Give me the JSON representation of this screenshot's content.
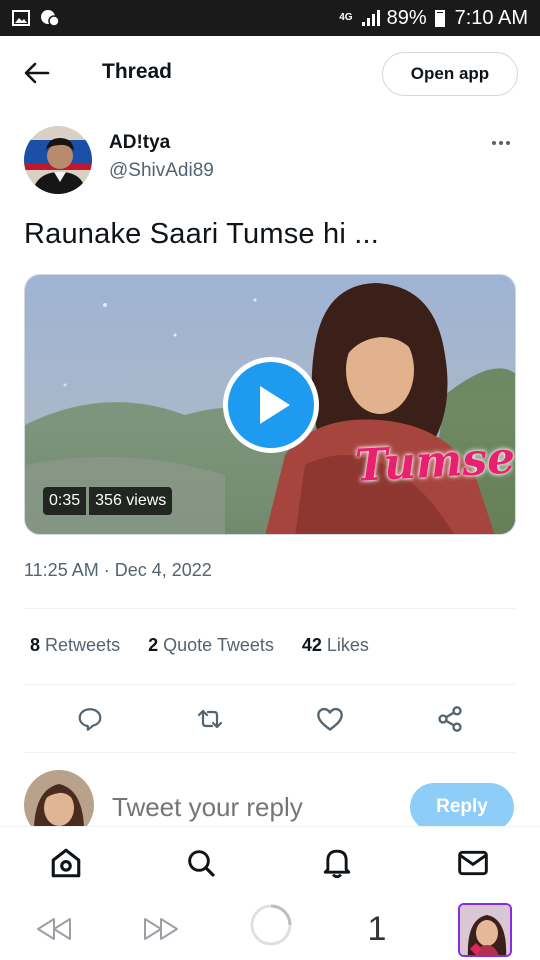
{
  "status_bar": {
    "network": "4G",
    "battery": "89%",
    "time": "7:10 AM"
  },
  "header": {
    "title": "Thread",
    "open_app_label": "Open app"
  },
  "tweet": {
    "author_name": "AD!tya",
    "author_handle": "@ShivAdi89",
    "text": "Raunake Saari Tumse hi ...",
    "video": {
      "duration": "0:35",
      "views": "356 views",
      "overlay_text": "Tumse hi"
    },
    "timestamp": "11:25 AM · Dec 4, 2022",
    "stats": {
      "retweets_count": "8",
      "retweets_label": "Retweets",
      "quote_count": "2",
      "quote_label": "Quote Tweets",
      "likes_count": "42",
      "likes_label": "Likes"
    }
  },
  "reply": {
    "placeholder": "Tweet your reply",
    "button_label": "Reply"
  },
  "bottom_nav": [
    "home-icon",
    "search-icon",
    "bell-icon",
    "mail-icon"
  ],
  "browser_bar": {
    "tab_count": "1"
  },
  "colors": {
    "accent": "#1d9bf0",
    "reply_button_disabled": "#8ecdf8",
    "secondary_text": "#536471",
    "primary_text": "#0f1419"
  }
}
